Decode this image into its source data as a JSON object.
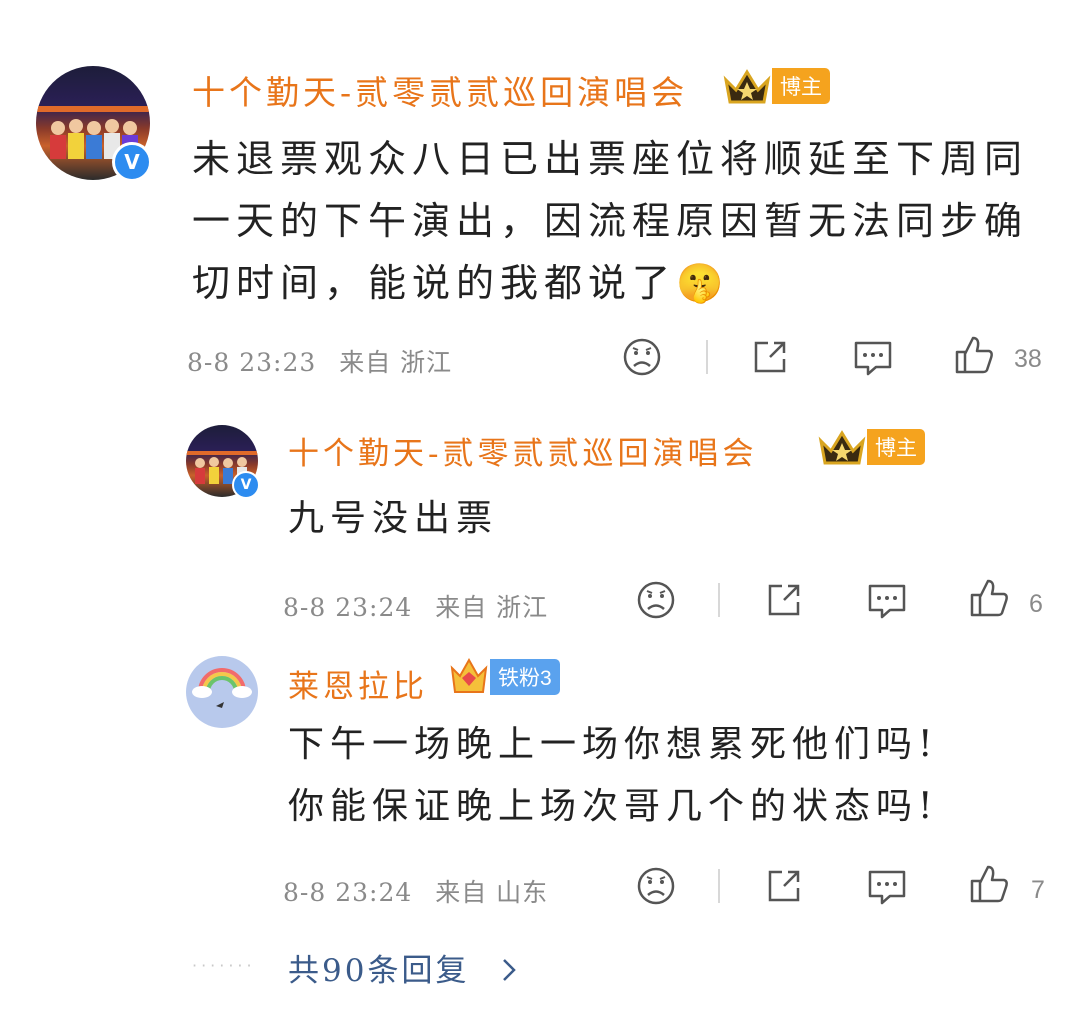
{
  "comments": [
    {
      "user": "十个勤天-贰零贰贰巡回演唱会",
      "badge": "博主",
      "text_lines": [
        "未退票观众八日已出票座位将顺延至下周同",
        "一天的下午演出，因流程原因暂无法同步确",
        "切时间，能说的我都说了"
      ],
      "emoji": "🤫",
      "time": "8-8 23:23",
      "source": "来自 浙江",
      "likes": "38"
    },
    {
      "user": "十个勤天-贰零贰贰巡回演唱会",
      "badge": "博主",
      "text_lines": [
        "九号没出票"
      ],
      "time": "8-8 23:24",
      "source": "来自 浙江",
      "likes": "6"
    },
    {
      "user": "莱恩拉比",
      "badge": "铁粉3",
      "text_lines": [
        "下午一场晚上一场你想累死他们吗!",
        "你能保证晚上场次哥几个的状态吗!"
      ],
      "time": "8-8 23:24",
      "source": "来自 山东",
      "likes": "7"
    }
  ],
  "more_replies": "共90条回复",
  "icons": {
    "verified": "verified-badge-icon",
    "crown": "crown-icon",
    "dislike": "sad-face-icon",
    "share": "share-icon",
    "comment": "comment-icon",
    "like": "thumb-up-icon",
    "chevron": "chevron-right-icon"
  },
  "colors": {
    "username": "#e8751a",
    "badge_blogger": "#f5a31e",
    "badge_fan": "#5aa2ee",
    "link": "#3b5b8a",
    "meta": "#8a8a8a"
  }
}
